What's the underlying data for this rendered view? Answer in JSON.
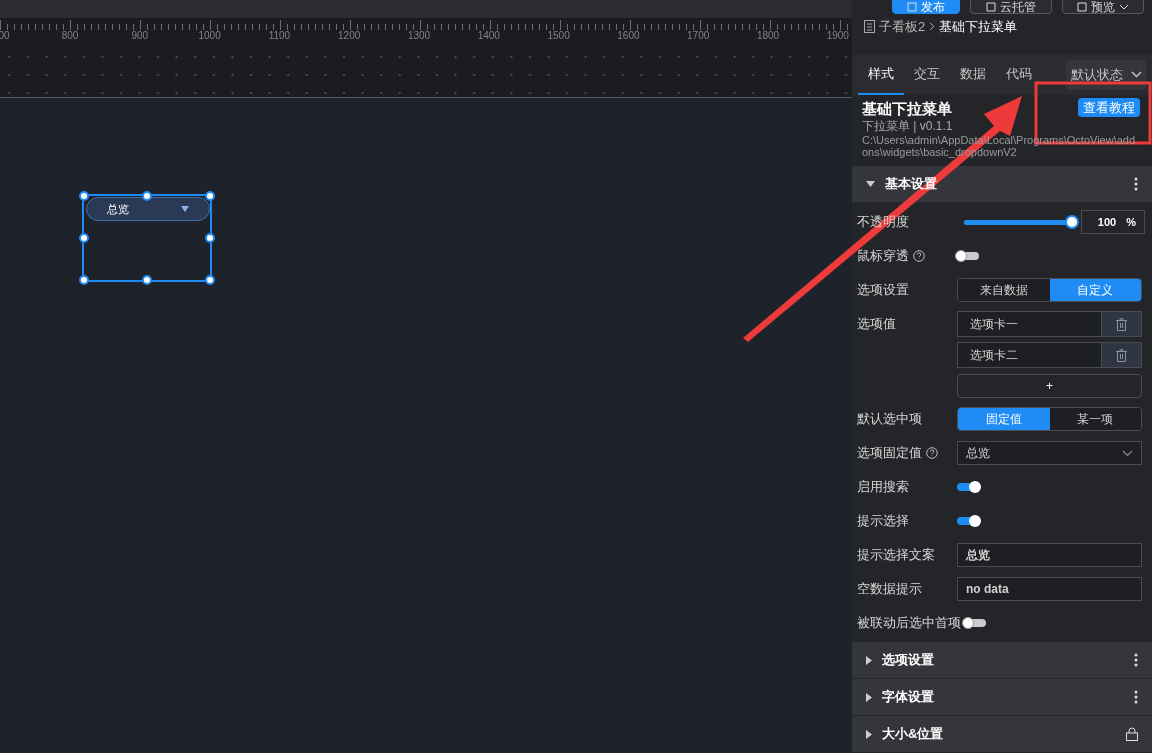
{
  "toolbar": {
    "buttons": [
      {
        "label": "发布",
        "kind": "primary"
      },
      {
        "label": "云托管",
        "kind": "default"
      },
      {
        "label": "预览",
        "kind": "dropdown"
      }
    ]
  },
  "ruler": {
    "labels": [
      "00",
      "800",
      "900",
      "1000",
      "1100",
      "1200",
      "1300",
      "1400",
      "1500",
      "1600",
      "1700",
      "1800",
      "1900"
    ]
  },
  "canvas": {
    "widget": {
      "value": "总览",
      "selected": true
    }
  },
  "panel": {
    "breadcrumb": [
      "子看板2",
      "基础下拉菜单"
    ],
    "tabs": [
      {
        "label": "样式",
        "selected": true
      },
      {
        "label": "交互",
        "selected": false
      },
      {
        "label": "数据",
        "selected": false
      },
      {
        "label": "代码",
        "selected": false
      }
    ],
    "state_select": "默认状态",
    "component": {
      "title": "基础下拉菜单",
      "version": "下拉菜单 | v0.1.1",
      "path": "C:\\Users\\admin\\AppData\\Local\\Programs\\OctoView\\addons\\widgets\\basic_dropdownV2",
      "tutorial_button": "查看教程"
    },
    "sections": [
      {
        "title": "基本设置",
        "expanded": true,
        "kind": "more",
        "rows": [
          {
            "kind": "slider",
            "label": "不透明度",
            "level": 1,
            "value": "100",
            "unit": "%"
          },
          {
            "kind": "toggle",
            "label": "鼠标穿透",
            "help": true,
            "on": false
          },
          {
            "kind": "segmented",
            "label": "选项设置",
            "options": [
              {
                "label": "来自数据",
                "selected": false
              },
              {
                "label": "自定义",
                "selected": true
              }
            ]
          },
          {
            "kind": "list",
            "label": "选项值",
            "items": [
              "选项卡一",
              "选项卡二"
            ],
            "add": "+"
          },
          {
            "kind": "segmented",
            "label": "默认选中项",
            "options": [
              {
                "label": "固定值",
                "selected": true
              },
              {
                "label": "某一项",
                "selected": false
              }
            ]
          },
          {
            "kind": "select",
            "label": "选项固定值",
            "help": true,
            "value": "总览"
          },
          {
            "kind": "toggle",
            "label": "启用搜索",
            "help": false,
            "on": true
          },
          {
            "kind": "toggle",
            "label": "提示选择",
            "help": false,
            "on": true
          },
          {
            "kind": "text",
            "label": "提示选择文案",
            "value": "总览"
          },
          {
            "kind": "text",
            "label": "空数据提示",
            "value": "no data"
          },
          {
            "kind": "toggle",
            "label": "被联动后选中首项",
            "help": false,
            "on": false
          }
        ]
      },
      {
        "title": "选项设置",
        "expanded": false,
        "kind": "more"
      },
      {
        "title": "字体设置",
        "expanded": false,
        "kind": "more"
      },
      {
        "title": "大小&位置",
        "expanded": false,
        "kind": "lock"
      }
    ]
  }
}
